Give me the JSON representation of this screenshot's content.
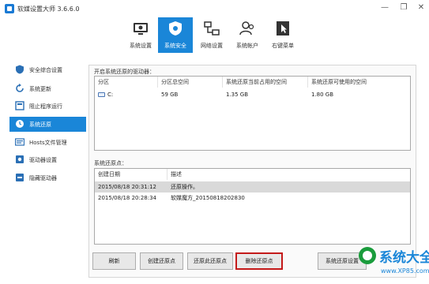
{
  "window": {
    "title": "软媒设置大师 3.6.6.0",
    "controls": [
      "minimize-icon",
      "restore-icon",
      "close-icon"
    ]
  },
  "toolbar": {
    "tabs": [
      {
        "label": "系统设置",
        "icon": "monitor-settings-icon"
      },
      {
        "label": "系统安全",
        "icon": "shield-icon",
        "active": true
      },
      {
        "label": "网络设置",
        "icon": "network-icon"
      },
      {
        "label": "系统帐户",
        "icon": "users-icon"
      },
      {
        "label": "右键菜单",
        "icon": "context-menu-icon"
      }
    ]
  },
  "sidebar": {
    "items": [
      {
        "label": "安全综合设置",
        "icon": "shield-settings-icon"
      },
      {
        "label": "系统更新",
        "icon": "refresh-icon"
      },
      {
        "label": "阻止程序运行",
        "icon": "block-program-icon"
      },
      {
        "label": "系统还原",
        "icon": "restore-icon",
        "active": true
      },
      {
        "label": "Hosts文件管理",
        "icon": "hosts-icon"
      },
      {
        "label": "驱动器设置",
        "icon": "drive-settings-icon"
      },
      {
        "label": "隐藏驱动器",
        "icon": "hidden-drive-icon"
      }
    ]
  },
  "drives": {
    "label": "开启系统还原的驱动器：",
    "columns": [
      "分区",
      "分区总空间",
      "系统还原当前占用的空间",
      "系统还原可使用的空间"
    ],
    "rows": [
      {
        "partition": "C:",
        "total": "59 GB",
        "used": "1.35 GB",
        "available": "1.80 GB"
      }
    ]
  },
  "restore_points": {
    "label": "系统还原点：",
    "columns": [
      "创建日期",
      "描述"
    ],
    "rows": [
      {
        "date": "2015/08/18 20:31:12",
        "description": "还原操作。",
        "selected": true
      },
      {
        "date": "2015/08/18 20:28:34",
        "description": "软媒魔方_20150818202830",
        "selected": false
      }
    ]
  },
  "buttons": {
    "refresh": "刷新",
    "create": "创建还原点",
    "restore": "还原此还原点",
    "delete": "删除还原点",
    "settings": "系统还原设置"
  },
  "watermark": {
    "title": "系统大全",
    "url": "www.XP85.com"
  },
  "colors": {
    "accent": "#1a86d8",
    "highlight_border": "#c41a1a",
    "selected_row": "#d9d9d9"
  }
}
